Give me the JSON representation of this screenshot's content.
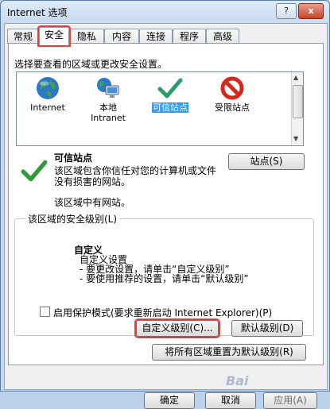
{
  "window": {
    "title": "Internet 选项",
    "help_label": "?",
    "close_label": "x"
  },
  "tabs": [
    {
      "label": "常规"
    },
    {
      "label": "安全",
      "active": true
    },
    {
      "label": "隐私"
    },
    {
      "label": "内容"
    },
    {
      "label": "连接"
    },
    {
      "label": "程序"
    },
    {
      "label": "高级"
    }
  ],
  "security": {
    "select_label": "选择要查看的区域或更改安全设置。",
    "zones": [
      {
        "label": "Internet",
        "icon": "globe-icon"
      },
      {
        "label": "本地\nIntranet",
        "icon": "local-intranet-icon"
      },
      {
        "label": "可信站点",
        "icon": "trusted-checkmark-icon",
        "selected": true
      },
      {
        "label": "受限站点",
        "icon": "restricted-no-icon"
      }
    ],
    "zone_title": "可信站点",
    "zone_description": "该区域包含你信任对您的计算机或文件没有损害的网站。",
    "zone_note": "该区域中有网站。",
    "sites_button": "站点(S)",
    "level_group_label": "该区域的安全级别(L)",
    "level_title": "自定义",
    "level_lines": [
      "自定义设置",
      "- 要更改设置，请单击“自定义级别”",
      "- 要使用推荐的设置，请单击“默认级别”"
    ],
    "protect_mode_label": "启用保护模式(要求重新启动 Internet Explorer)(P)",
    "custom_level_button": "自定义级别(C)...",
    "default_level_button": "默认级别(D)",
    "reset_all_button": "将所有区域重置为默认级别(R)"
  },
  "footer": {
    "ok": "确定",
    "cancel": "取消",
    "apply": "应用(A)"
  },
  "watermark": "Bai"
}
